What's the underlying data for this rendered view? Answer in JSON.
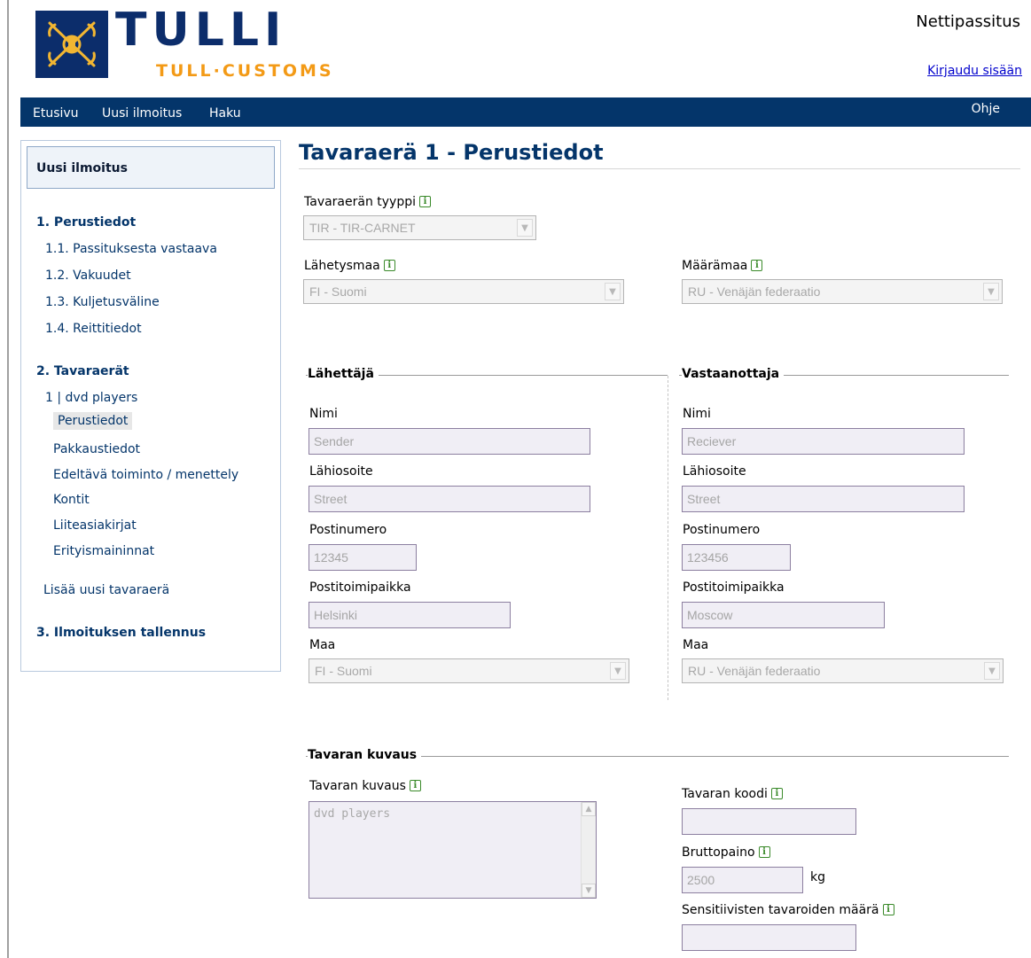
{
  "header": {
    "logo_main": "TULLI",
    "logo_sub": "TULL·CUSTOMS",
    "site_title": "Nettipassitus",
    "login_link": "Kirjaudu sisään"
  },
  "nav": {
    "items": [
      "Etusivu",
      "Uusi ilmoitus",
      "Haku"
    ],
    "help": "Ohje"
  },
  "sidebar": {
    "header": "Uusi ilmoitus",
    "section1": "1. Perustiedot",
    "section1_items": [
      "1.1. Passituksesta vastaava",
      "1.2. Vakuudet",
      "1.3. Kuljetusväline",
      "1.4. Reittitiedot"
    ],
    "section2": "2. Tavaraerät",
    "consignment": "1 | dvd players",
    "consignment_items": [
      "Perustiedot",
      "Pakkaustiedot",
      "Edeltävä toiminto / menettely",
      "Kontit",
      "Liiteasiakirjat",
      "Erityismaininnat"
    ],
    "add_consignment": "Lisää uusi tavaraerä",
    "section3": "3. Ilmoituksen tallennus"
  },
  "main": {
    "title": "Tavaraerä 1 - Perustiedot",
    "type_label": "Tavaraerän tyyppi",
    "type_value": "TIR - TIR-CARNET",
    "dispatch_label": "Lähetysmaa",
    "dispatch_value": "FI - Suomi",
    "destination_label": "Määrämaa",
    "destination_value": "RU - Venäjän federaatio",
    "sender": {
      "legend": "Lähettäjä",
      "name_label": "Nimi",
      "name_value": "Sender",
      "street_label": "Lähiosoite",
      "street_value": "Street",
      "postcode_label": "Postinumero",
      "postcode_value": "12345",
      "city_label": "Postitoimipaikka",
      "city_value": "Helsinki",
      "country_label": "Maa",
      "country_value": "FI - Suomi"
    },
    "receiver": {
      "legend": "Vastaanottaja",
      "name_label": "Nimi",
      "name_value": "Reciever",
      "street_label": "Lähiosoite",
      "street_value": "Street",
      "postcode_label": "Postinumero",
      "postcode_value": "123456",
      "city_label": "Postitoimipaikka",
      "city_value": "Moscow",
      "country_label": "Maa",
      "country_value": "RU - Venäjän federaatio"
    },
    "goods": {
      "legend": "Tavaran kuvaus",
      "description_label": "Tavaran kuvaus",
      "description_value": "dvd players",
      "code_label": "Tavaran koodi",
      "code_value": "",
      "gross_label": "Bruttopaino",
      "gross_value": "2500",
      "gross_unit": "kg",
      "sensitive_label": "Sensitiivisten tavaroiden määrä",
      "sensitive_value": ""
    }
  },
  "colors": {
    "navbar": "#04356a",
    "title": "#04356a",
    "logo_orange": "#f39a16",
    "logo_blue": "#0c2d6b",
    "input_bg": "#f0eef5",
    "info_green": "#3a8a2a"
  },
  "icons": {
    "info": "info-icon",
    "logo": "customs-crossed-keys-logo",
    "dropdown": "chevron-down-icon"
  }
}
